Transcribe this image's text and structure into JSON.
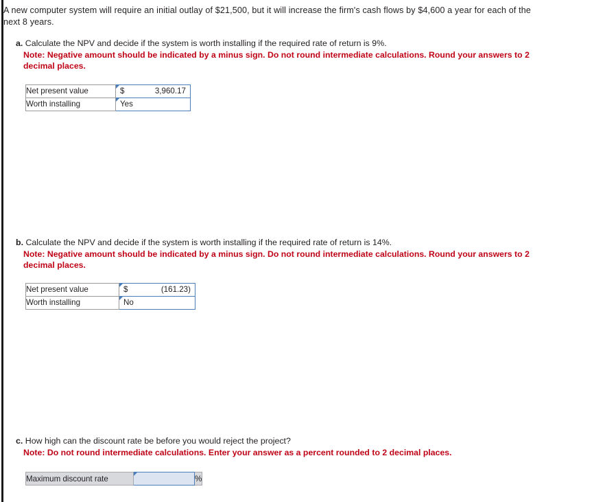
{
  "document": {
    "intro": "A new computer system will require an initial outlay of $21,500, but it will increase the firm's cash flows by $4,600 a year for each of the next 8 years.",
    "note_color": "#c00418",
    "input_border_color": "#4a7ebb"
  },
  "parts": {
    "a": {
      "letter": "a.",
      "question": "Calculate the NPV and decide if the system is worth installing if the required rate of return is 9%.",
      "note": "Note: Negative amount should be indicated by a minus sign. Do not round intermediate calculations. Round your answers to 2 decimal places.",
      "rows": [
        {
          "label": "Net present value",
          "currency": "$",
          "value": "3,960.17"
        },
        {
          "label": "Worth installing",
          "value": "Yes"
        }
      ]
    },
    "b": {
      "letter": "b.",
      "question": "Calculate the NPV and decide if the system is worth installing if the required rate of return is 14%.",
      "note": "Note: Negative amount should be indicated by a minus sign. Do not round intermediate calculations. Round your answers to 2 decimal places.",
      "rows": [
        {
          "label": "Net present value",
          "currency": "$",
          "value": "(161.23)"
        },
        {
          "label": "Worth installing",
          "value": "No"
        }
      ]
    },
    "c": {
      "letter": "c.",
      "question": "How high can the discount rate be before you would reject the project?",
      "note": "Note: Do not round intermediate calculations. Enter your answer as a percent rounded to 2 decimal places.",
      "row": {
        "label": "Maximum discount rate",
        "value": "",
        "suffix": "%"
      }
    }
  }
}
